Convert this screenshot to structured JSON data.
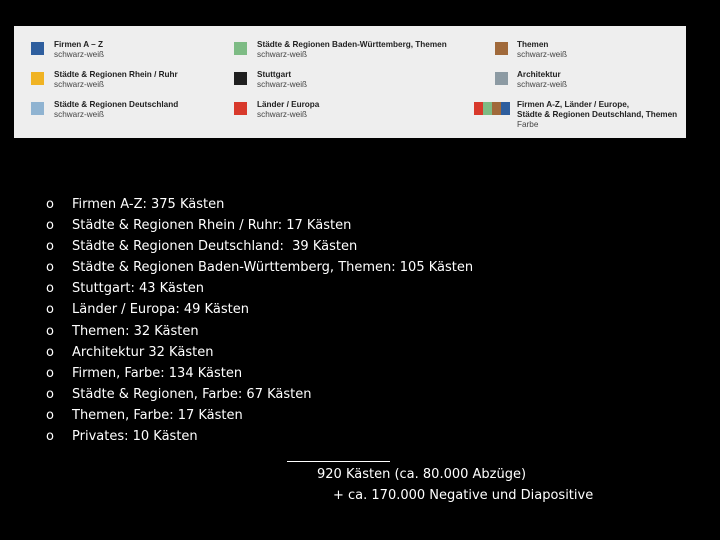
{
  "legend": {
    "entries": [
      {
        "title": "Firmen A – Z",
        "subtitle": "schwarz-weiß",
        "color": "#2e5e9e"
      },
      {
        "title": "Städte & Regionen Rhein / Ruhr",
        "subtitle": "schwarz-weiß",
        "color": "#f0b323"
      },
      {
        "title": "Städte & Regionen Deutschland",
        "subtitle": "schwarz-weiß",
        "color": "#8fb3d1"
      },
      {
        "title": "Städte & Regionen Baden-Württemberg, Themen",
        "subtitle": "schwarz-weiß",
        "color": "#7dbb84"
      },
      {
        "title": "Stuttgart",
        "subtitle": "schwarz-weiß",
        "color": "#1f1f1f"
      },
      {
        "title": "Länder / Europa",
        "subtitle": "schwarz-weiß",
        "color": "#d8392b"
      },
      {
        "title": "Themen",
        "subtitle": "schwarz-weiß",
        "color": "#a0693a"
      },
      {
        "title": "Architektur",
        "subtitle": "schwarz-weiß",
        "color": "#8c9aa3"
      },
      {
        "title": "Firmen A-Z, Länder / Europe,",
        "title2": "Städte & Regionen Deutschland, Themen",
        "subtitle": "Farbe",
        "colors": [
          "#d8392b",
          "#7dbb84",
          "#a0693a",
          "#2e5e9e"
        ]
      }
    ]
  },
  "stats": {
    "bullet": "o",
    "items": [
      "Firmen A-Z: 375 Kästen",
      "Städte & Regionen Rhein / Ruhr: 17 Kästen",
      "Städte & Regionen Deutschland:  39 Kästen",
      "Städte & Regionen Baden-Württemberg, Themen: 105 Kästen",
      "Stuttgart: 43 Kästen",
      "Länder / Europa: 49 Kästen",
      "Themen: 32 Kästen",
      "Architektur 32 Kästen",
      "Firmen, Farbe: 134 Kästen",
      "Städte & Regionen, Farbe: 67 Kästen",
      "Themen, Farbe: 17 Kästen",
      "Privates: 10 Kästen"
    ]
  },
  "summary": {
    "total": "920 Kästen (ca. 80.000 Abzüge)",
    "extra": "+ ca. 170.000 Negative und Diapositive"
  }
}
